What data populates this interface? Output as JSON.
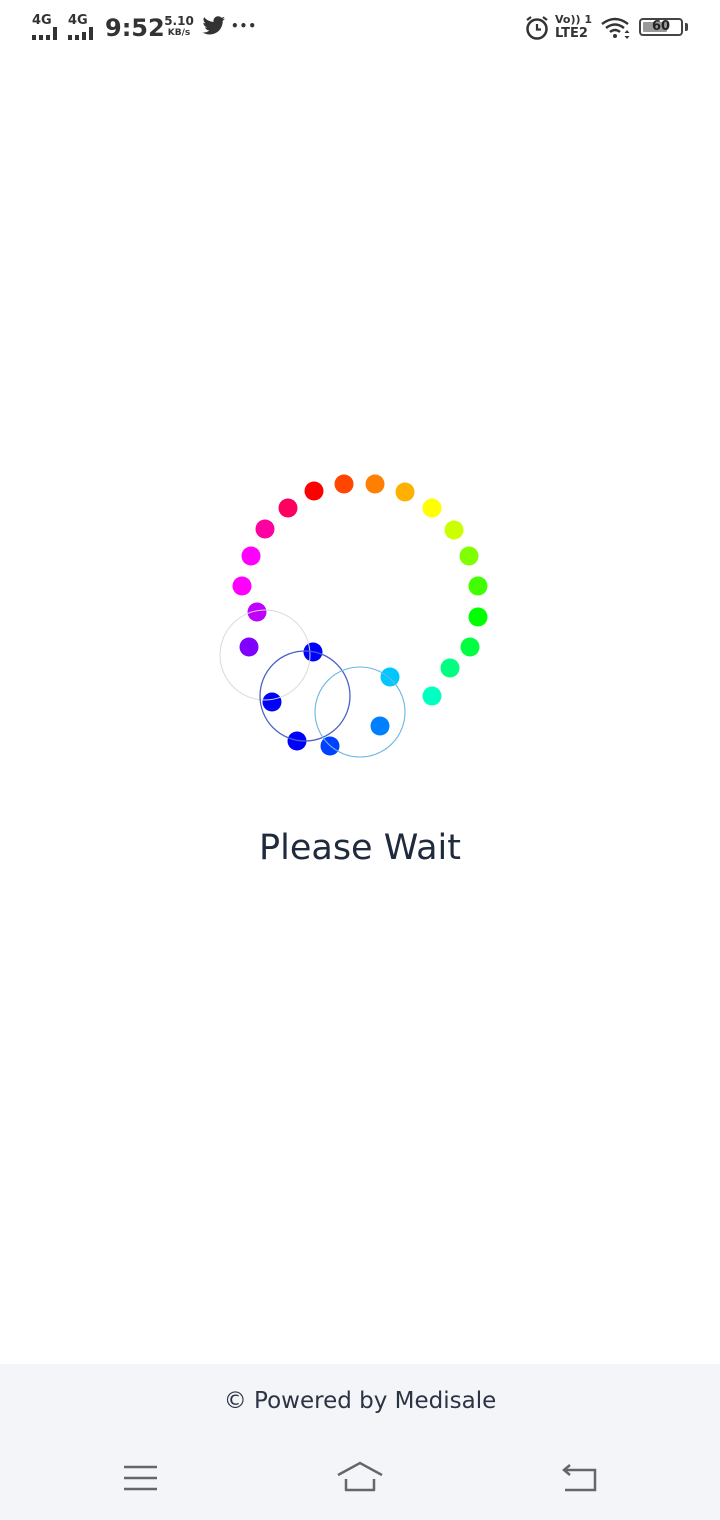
{
  "status_bar": {
    "sim1_label": "4G",
    "sim2_label": "4G",
    "time": "9:52",
    "net_speed_value": "5.10",
    "net_speed_unit": "KB/s",
    "app_icon": "twitter-icon",
    "more_indicator": "•••",
    "volte_top": "Vo)) 1",
    "volte_bottom": "LTE2",
    "battery_level": "60"
  },
  "loader": {
    "message": "Please Wait",
    "dot_colors": [
      "#ff0000",
      "#ff4500",
      "#ff8000",
      "#ffb000",
      "#ffff00",
      "#ccff00",
      "#80ff00",
      "#40ff00",
      "#00ff00",
      "#00ff40",
      "#00ff80",
      "#00ffc0",
      "#00c8ff",
      "#0080ff",
      "#0040ff",
      "#0000ff",
      "#8000ff",
      "#c000ff",
      "#ff00ff",
      "#ff00a0",
      "#ff0060"
    ]
  },
  "footer": {
    "powered_by": "© Powered by Medisale"
  },
  "nav": {
    "menu_icon": "menu-icon",
    "home_icon": "home-icon",
    "back_icon": "back-icon"
  }
}
